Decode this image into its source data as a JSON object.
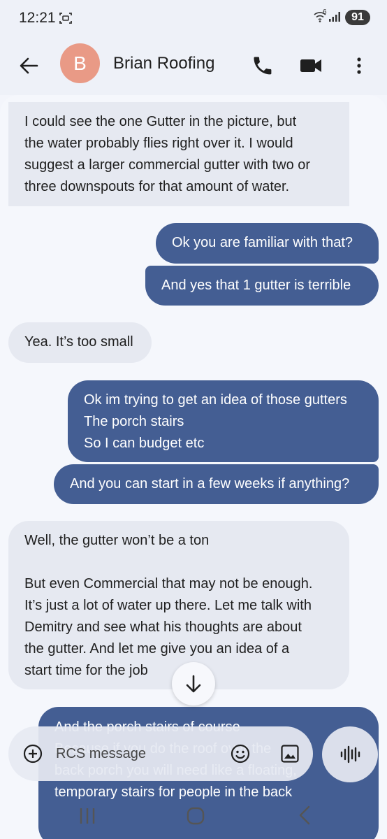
{
  "status_bar": {
    "time": "12:21",
    "battery": "91",
    "icons": [
      "screen-record-icon",
      "wifi-icon",
      "signal-icon"
    ]
  },
  "header": {
    "avatar_letter": "B",
    "avatar_color": "#e99a86",
    "contact_name": "Brian Roofing",
    "icons": [
      "back-arrow-icon",
      "phone-icon",
      "video-call-icon",
      "more-vert-icon"
    ]
  },
  "colors": {
    "outgoing_bubble": "#445e93",
    "incoming_bubble": "#e6e9f1"
  },
  "messages": [
    {
      "direction": "incoming",
      "text": "I could see the one Gutter in the picture, but\nthe water probably flies right over it. I would\nsuggest a larger commercial gutter with two or\nthree downspouts for that amount of water."
    },
    {
      "direction": "outgoing",
      "text": "Ok you are familiar with that?"
    },
    {
      "direction": "outgoing",
      "text": "And yes that 1 gutter is terrible"
    },
    {
      "direction": "incoming",
      "text": "Yea. It’s too small"
    },
    {
      "direction": "outgoing",
      "text": "Ok im trying to get an idea of those gutters\nThe porch stairs\nSo I can budget etc"
    },
    {
      "direction": "outgoing",
      "text": "And you can start in a few weeks if anything?"
    },
    {
      "direction": "incoming",
      "text": "Well, the gutter won’t be a ton\n\nBut even Commercial that may not be enough.\nIt’s just a lot of water up there. Let me talk with\nDemitry and see what his thoughts are about\nthe gutter. And let me give you an idea of a\nstart time for the job"
    },
    {
      "direction": "outgoing",
      "text": "And the porch stairs of course\nBecause if you do the roof over the\nback porch you will need like a floating,\ntemporary stairs for people in the back"
    }
  ],
  "compose": {
    "placeholder": "RCS message",
    "icons": [
      "add-circle-icon",
      "emoji-icon",
      "gallery-icon",
      "voice-waveform-icon"
    ]
  },
  "scroll_down_icon": "arrow-down-icon",
  "nav": {
    "icons": [
      "recents-icon",
      "home-icon",
      "back-icon"
    ]
  }
}
